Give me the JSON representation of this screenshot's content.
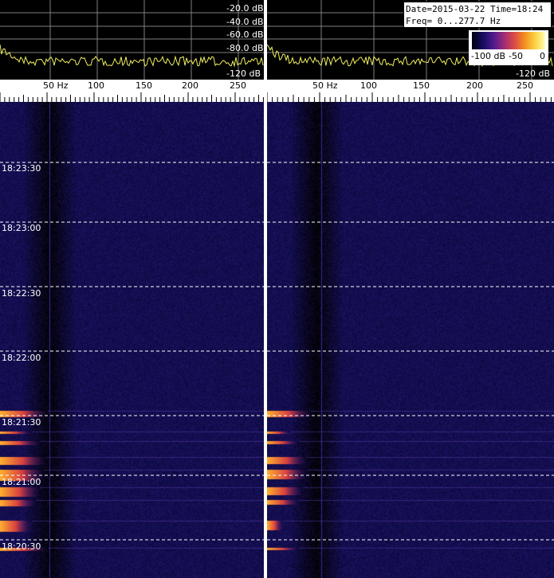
{
  "info": {
    "date_line": "Date=2015-03-22 Time=18:24",
    "freq_line": "Freq= 0...277.7 Hz"
  },
  "colorbar": {
    "min_label": "-100 dB",
    "mid_label": "-50",
    "max_label": "0"
  },
  "spectrum": {
    "db_labels": [
      "-20.0 dB",
      "-40.0 dB",
      "-60.0 dB",
      "-80.0 dB",
      "-120 dB"
    ],
    "trace_color": "#f0f060",
    "grid_color": "#808080"
  },
  "freq_axis": {
    "labels": [
      "50 Hz",
      "100",
      "150",
      "200",
      "250"
    ]
  },
  "waterfall": {
    "time_labels": [
      "18:23:30",
      "18:23:00",
      "18:22:30",
      "18:22:00",
      "18:21:30",
      "18:21:00",
      "18:20:30"
    ],
    "background_color": "#1a1060"
  }
}
